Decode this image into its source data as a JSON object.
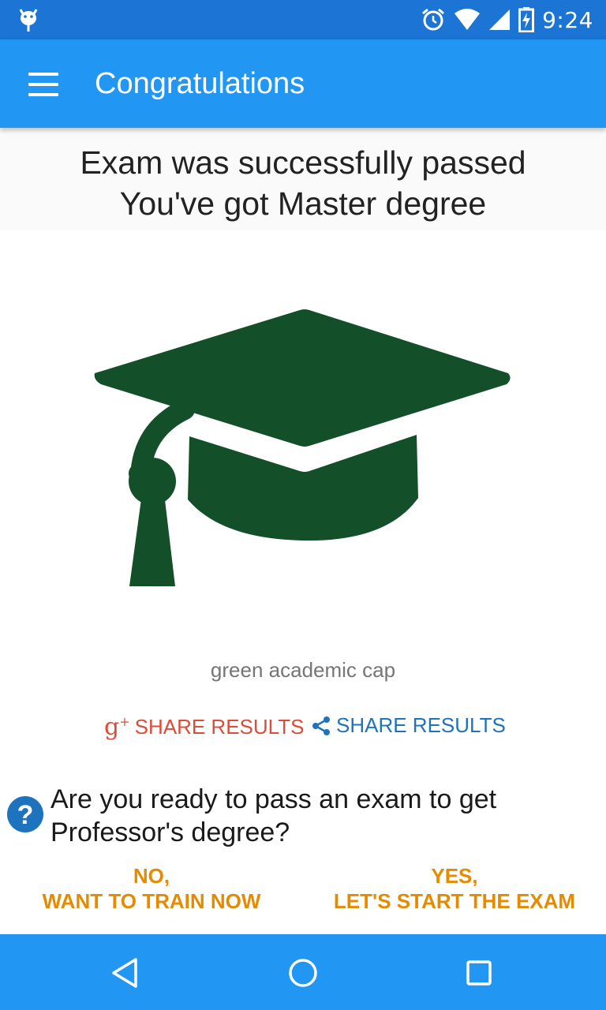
{
  "status_bar": {
    "time": "9:24",
    "icons": [
      "android-debug-icon",
      "alarm-icon",
      "wifi-icon",
      "signal-icon",
      "battery-charging-icon"
    ]
  },
  "app_bar": {
    "title": "Congratulations",
    "menu_icon": "hamburger-menu-icon"
  },
  "header": {
    "line1": "Exam was successfully passed",
    "line2": "You've got Master degree"
  },
  "image": {
    "caption": "green academic cap",
    "icon": "graduation-cap-icon",
    "color": "#134f29"
  },
  "share": {
    "gplus_icon_text": "g",
    "gplus_icon_sup": "+",
    "gplus_label": "SHARE RESULTS",
    "generic_label": "SHARE RESULTS",
    "gplus_color": "#dd4b39",
    "generic_color": "#1e73be"
  },
  "question": {
    "text_line1": "Are you ready to pass an exam to get",
    "text_line2": "Professor's degree?",
    "icon": "help-circle-icon"
  },
  "actions": {
    "no_line1": "NO,",
    "no_line2": "WANT TO TRAIN NOW",
    "yes_line1": "YES,",
    "yes_line2": "LET'S START THE EXAM",
    "color": "#e68a00"
  },
  "nav_bar": {
    "icons": [
      "back-icon",
      "home-icon",
      "recents-icon"
    ]
  },
  "colors": {
    "primary": "#2196f3",
    "primary_dark": "#1c74d4"
  }
}
